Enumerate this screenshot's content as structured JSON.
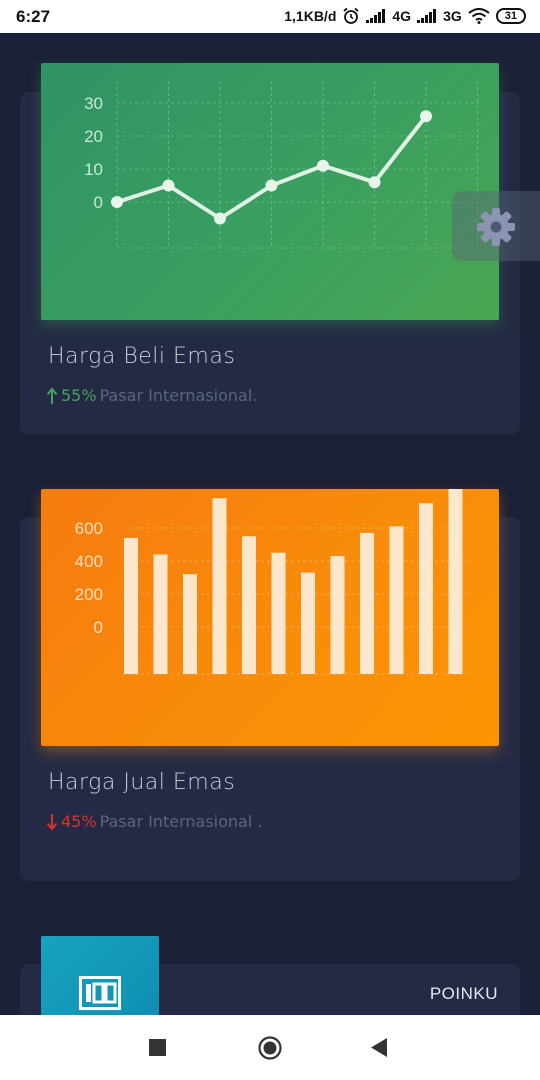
{
  "status_bar": {
    "time": "6:27",
    "net_speed": "1,1KB/d",
    "network_1": "4G",
    "network_2": "3G",
    "battery": "31"
  },
  "cards": [
    {
      "title": "Harga Beli Emas",
      "trend": "up",
      "percent": "55%",
      "caption": "Pasar Internasional."
    },
    {
      "title": "Harga Jual Emas",
      "trend": "down",
      "percent": "45%",
      "caption": "Pasar Internasional ."
    }
  ],
  "poin_card": {
    "label": "POINKU",
    "icon": "100-points-icon"
  },
  "settings": {
    "icon": "gear-icon"
  },
  "nav": [
    "recent-apps-icon",
    "home-icon",
    "back-icon"
  ],
  "colors": {
    "background": "#1b2036",
    "card": "#242a45",
    "green_panel": "#3a9f5f",
    "orange_panel": "#f98c0a",
    "teal_box": "#18a3bd",
    "up": "#43a35a",
    "down": "#d8332c"
  },
  "chart_data": [
    {
      "type": "line",
      "yticks": [
        "30",
        "20",
        "10",
        "0"
      ],
      "ylim": [
        0,
        30
      ],
      "values": [
        0,
        5,
        -5,
        5,
        11,
        6,
        26
      ],
      "grid": true
    },
    {
      "type": "bar",
      "yticks": [
        "600",
        "400",
        "200",
        "0"
      ],
      "ylim": [
        0,
        600
      ],
      "values": [
        540,
        440,
        320,
        780,
        550,
        450,
        330,
        430,
        570,
        610,
        750,
        880
      ],
      "grid": true
    }
  ]
}
